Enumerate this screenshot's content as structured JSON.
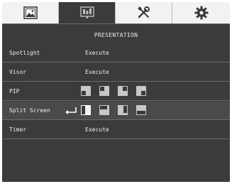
{
  "tabs": [
    {
      "icon": "picture-icon"
    },
    {
      "icon": "presentation-icon",
      "active": true
    },
    {
      "icon": "wrench-screwdriver-icon"
    },
    {
      "icon": "gear-icon"
    }
  ],
  "section_title": "PRESENTATION",
  "rows": [
    {
      "label": "Spotlight",
      "value": "Execute"
    },
    {
      "label": "Visor",
      "value": "Execute"
    },
    {
      "label": "PIP",
      "options": [
        "pip-bottom-left",
        "pip-top-left",
        "pip-top-right",
        "pip-bottom-right"
      ]
    },
    {
      "label": "Split Screen",
      "options": [
        "split-left-right",
        "split-top",
        "split-right",
        "split-bottom"
      ],
      "selected": true
    },
    {
      "label": "Timer",
      "value": "Execute"
    }
  ]
}
